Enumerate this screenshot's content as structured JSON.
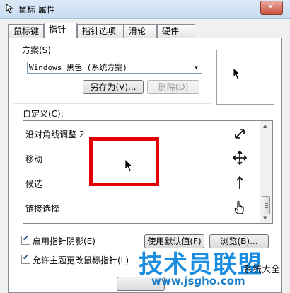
{
  "window": {
    "title": "鼠标 属性"
  },
  "tabs": [
    {
      "label": "鼠标键"
    },
    {
      "label": "指针"
    },
    {
      "label": "指针选项"
    },
    {
      "label": "滑轮"
    },
    {
      "label": "硬件"
    }
  ],
  "scheme": {
    "label": "方案(S)",
    "selected": "Windows 黑色 (系统方案)",
    "save_as_label": "另存为(V)...",
    "delete_label": "删除(D)"
  },
  "custom": {
    "label": "自定义(C):",
    "items": [
      {
        "label": "沿对角线调整 2",
        "icon": "diagonal-resize-icon"
      },
      {
        "label": "移动",
        "icon": "move-icon"
      },
      {
        "label": "候选",
        "icon": "alternate-select-icon"
      },
      {
        "label": "链接选择",
        "icon": "hand-icon"
      }
    ]
  },
  "options": {
    "shadow_label": "启用指针阴影(E)",
    "shadow_checked": true,
    "theme_label": "允许主题更改鼠标指针(L)",
    "theme_checked": true,
    "default_button": "使用默认值(F)",
    "browse_button": "浏览(B)..."
  },
  "watermark": {
    "main": "技术员联盟",
    "url": "www.jsgho.com",
    "suffix": "系统大全"
  },
  "colors": {
    "highlight_box": "#e40000",
    "watermark": "#1a8de0"
  }
}
